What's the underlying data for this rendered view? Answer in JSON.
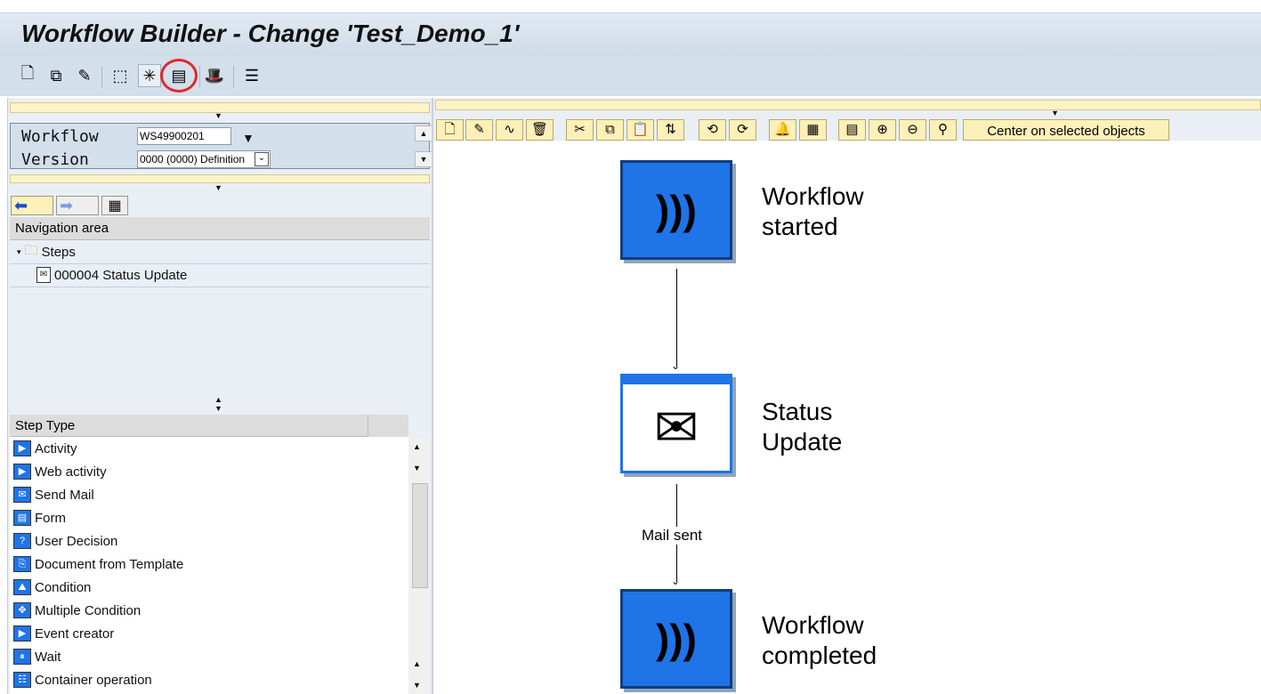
{
  "window": {
    "title": "Workflow Builder - Change 'Test_Demo_1'"
  },
  "toolbar": {
    "icons": [
      "new-document-icon",
      "copy-icon",
      "edit-pencil-icon",
      "hierarchy-icon",
      "wizard-icon",
      "workflow-container-icon",
      "hat-icon",
      "list-icon"
    ]
  },
  "header": {
    "workflow_label": "Workflow",
    "workflow_value": "WS49900201",
    "version_label": "Version",
    "version_value": "0000 (0000) Definition"
  },
  "navigation": {
    "title": "Navigation area",
    "folder": "Steps",
    "items": [
      "000004 Status Update"
    ]
  },
  "step_types": {
    "title": "Step Type",
    "items": [
      "Activity",
      "Web activity",
      "Send Mail",
      "Form",
      "User Decision",
      "Document from Template",
      "Condition",
      "Multiple Condition",
      "Event creator",
      "Wait",
      "Container operation"
    ]
  },
  "graphic": {
    "center_button": "Center on selected objects",
    "nodes": [
      {
        "line1": "Workflow",
        "line2": "started"
      },
      {
        "line1": "Status",
        "line2": "Update"
      },
      {
        "line1": "Workflow",
        "line2": "completed"
      }
    ],
    "edge_label": "Mail sent"
  }
}
